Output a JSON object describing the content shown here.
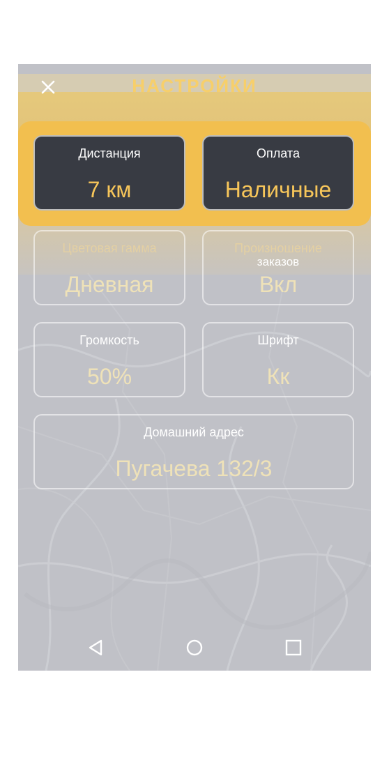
{
  "header": {
    "title": "НАСТРОЙКИ",
    "close_icon": "close-icon"
  },
  "settings": {
    "distance": {
      "label": "Дистанция",
      "value": "7 км"
    },
    "payment": {
      "label": "Оплата",
      "value": "Наличные"
    },
    "color_theme": {
      "label": "Цветовая гамма",
      "value": "Дневная"
    },
    "pronunciation": {
      "label": "Произношение",
      "label_line2": "заказов",
      "value": "Вкл"
    },
    "volume": {
      "label": "Громкость",
      "value": "50%"
    },
    "font": {
      "label": "Шрифт",
      "value": "Кк"
    },
    "home_address": {
      "label": "Домашний адрес",
      "value": "Пугачева 132/3"
    }
  },
  "navbar": {
    "icons": [
      "back-triangle-icon",
      "home-circle-icon",
      "recents-square-icon"
    ]
  },
  "colors": {
    "accent": "#f2bf4f",
    "card_dark": "#383b43",
    "value_text": "#f7c65a",
    "screen_bg": "#c0c1c7"
  }
}
